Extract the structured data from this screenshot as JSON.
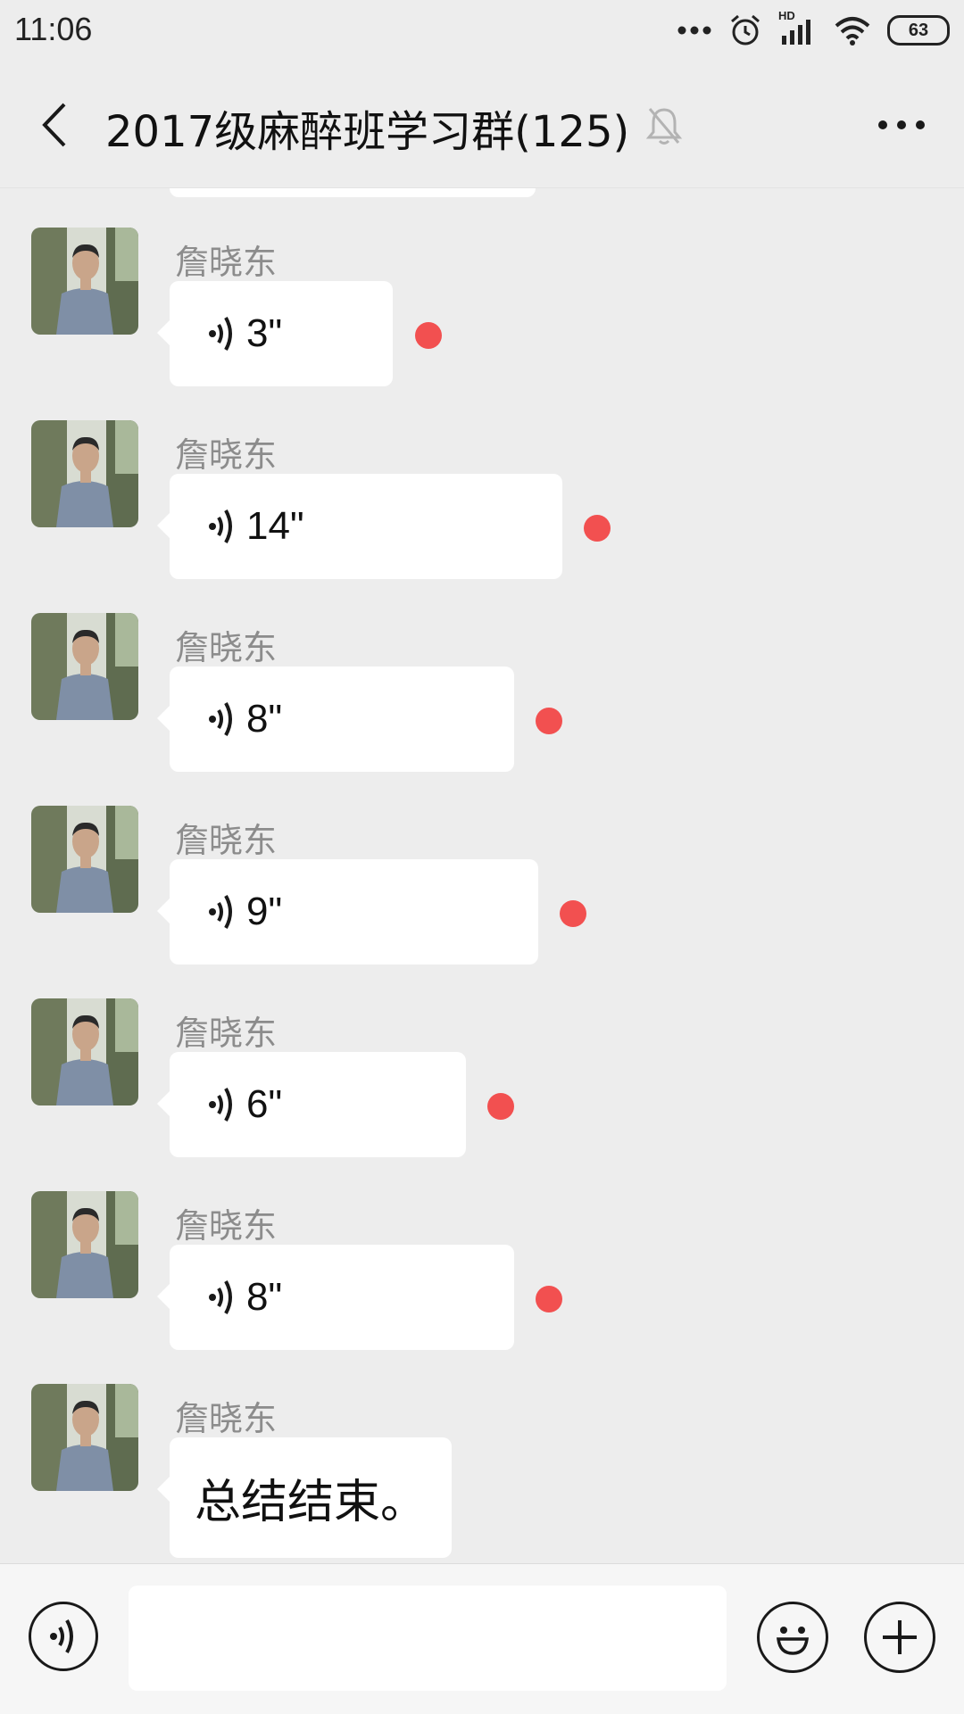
{
  "status_bar": {
    "time": "11:06",
    "battery": "63",
    "network": "HD",
    "icons": [
      "more-dots-icon",
      "alarm-icon",
      "signal-icon",
      "wifi-icon",
      "battery-icon"
    ]
  },
  "nav": {
    "title": "2017级麻醉班学习群(125)",
    "icons": [
      "back-icon",
      "mute-bell-icon",
      "more-icon"
    ]
  },
  "messages": [
    {
      "sender": "詹晓东",
      "type": "voice",
      "duration": "3\"",
      "unread": true
    },
    {
      "sender": "詹晓东",
      "type": "voice",
      "duration": "14\"",
      "unread": true
    },
    {
      "sender": "詹晓东",
      "type": "voice",
      "duration": "8\"",
      "unread": true
    },
    {
      "sender": "詹晓东",
      "type": "voice",
      "duration": "9\"",
      "unread": true
    },
    {
      "sender": "詹晓东",
      "type": "voice",
      "duration": "6\"",
      "unread": true
    },
    {
      "sender": "詹晓东",
      "type": "voice",
      "duration": "8\"",
      "unread": true
    },
    {
      "sender": "詹晓东",
      "type": "text",
      "text": "总结结束。"
    }
  ],
  "input_bar": {
    "value": "",
    "icons": [
      "voice-mode-icon",
      "emoji-icon",
      "plus-icon"
    ]
  },
  "colors": {
    "background": "#ededed",
    "bubble": "#ffffff",
    "unread_dot": "#f25050",
    "sender_name": "#8c8c8c"
  }
}
